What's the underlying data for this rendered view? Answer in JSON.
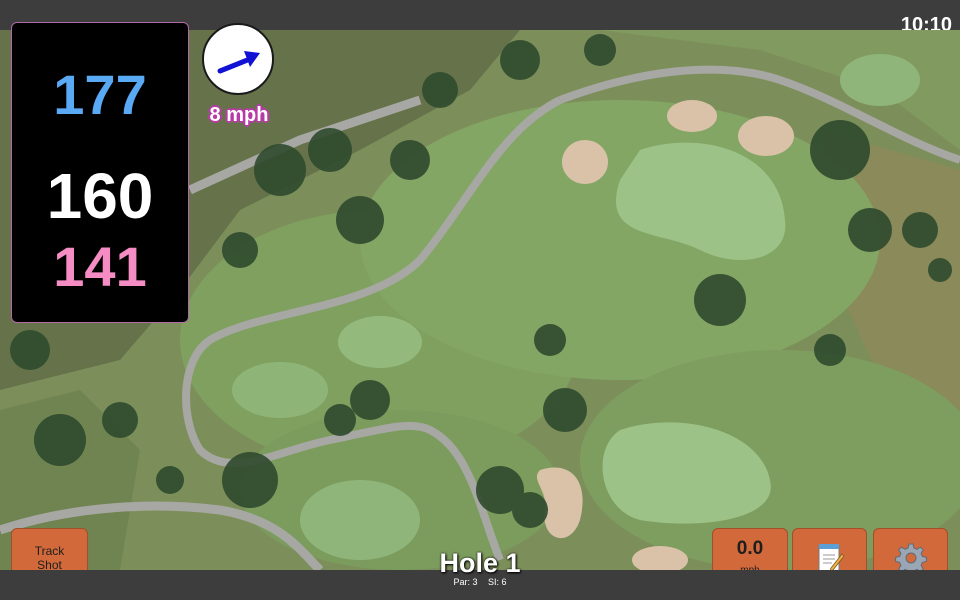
{
  "clock": "10:10",
  "distances": {
    "back": "177",
    "middle": "160",
    "front": "141",
    "colors": {
      "back": "#5aa9f5",
      "middle": "#ffffff",
      "front": "#f58dc4"
    }
  },
  "wind": {
    "speed": "8 mph",
    "arrow_color": "#1212d4"
  },
  "buttons": {
    "track_shot": {
      "line1": "Track",
      "line2": "Shot"
    },
    "speed": {
      "value": "0.0",
      "unit": "mph"
    },
    "notes_icon": "notepad-icon",
    "settings_icon": "gear-icon",
    "button_color": "#d2693a"
  },
  "hole": {
    "title": "Hole 1",
    "par": "Par: 3",
    "si": "SI: 6"
  },
  "map": {
    "fairway_color": "#7a9a5c",
    "green_color": "#8fb57a",
    "bunker_color": "#d9c2a8",
    "path_color": "#a7a7a3",
    "tree_color": "#2f4a2e"
  }
}
